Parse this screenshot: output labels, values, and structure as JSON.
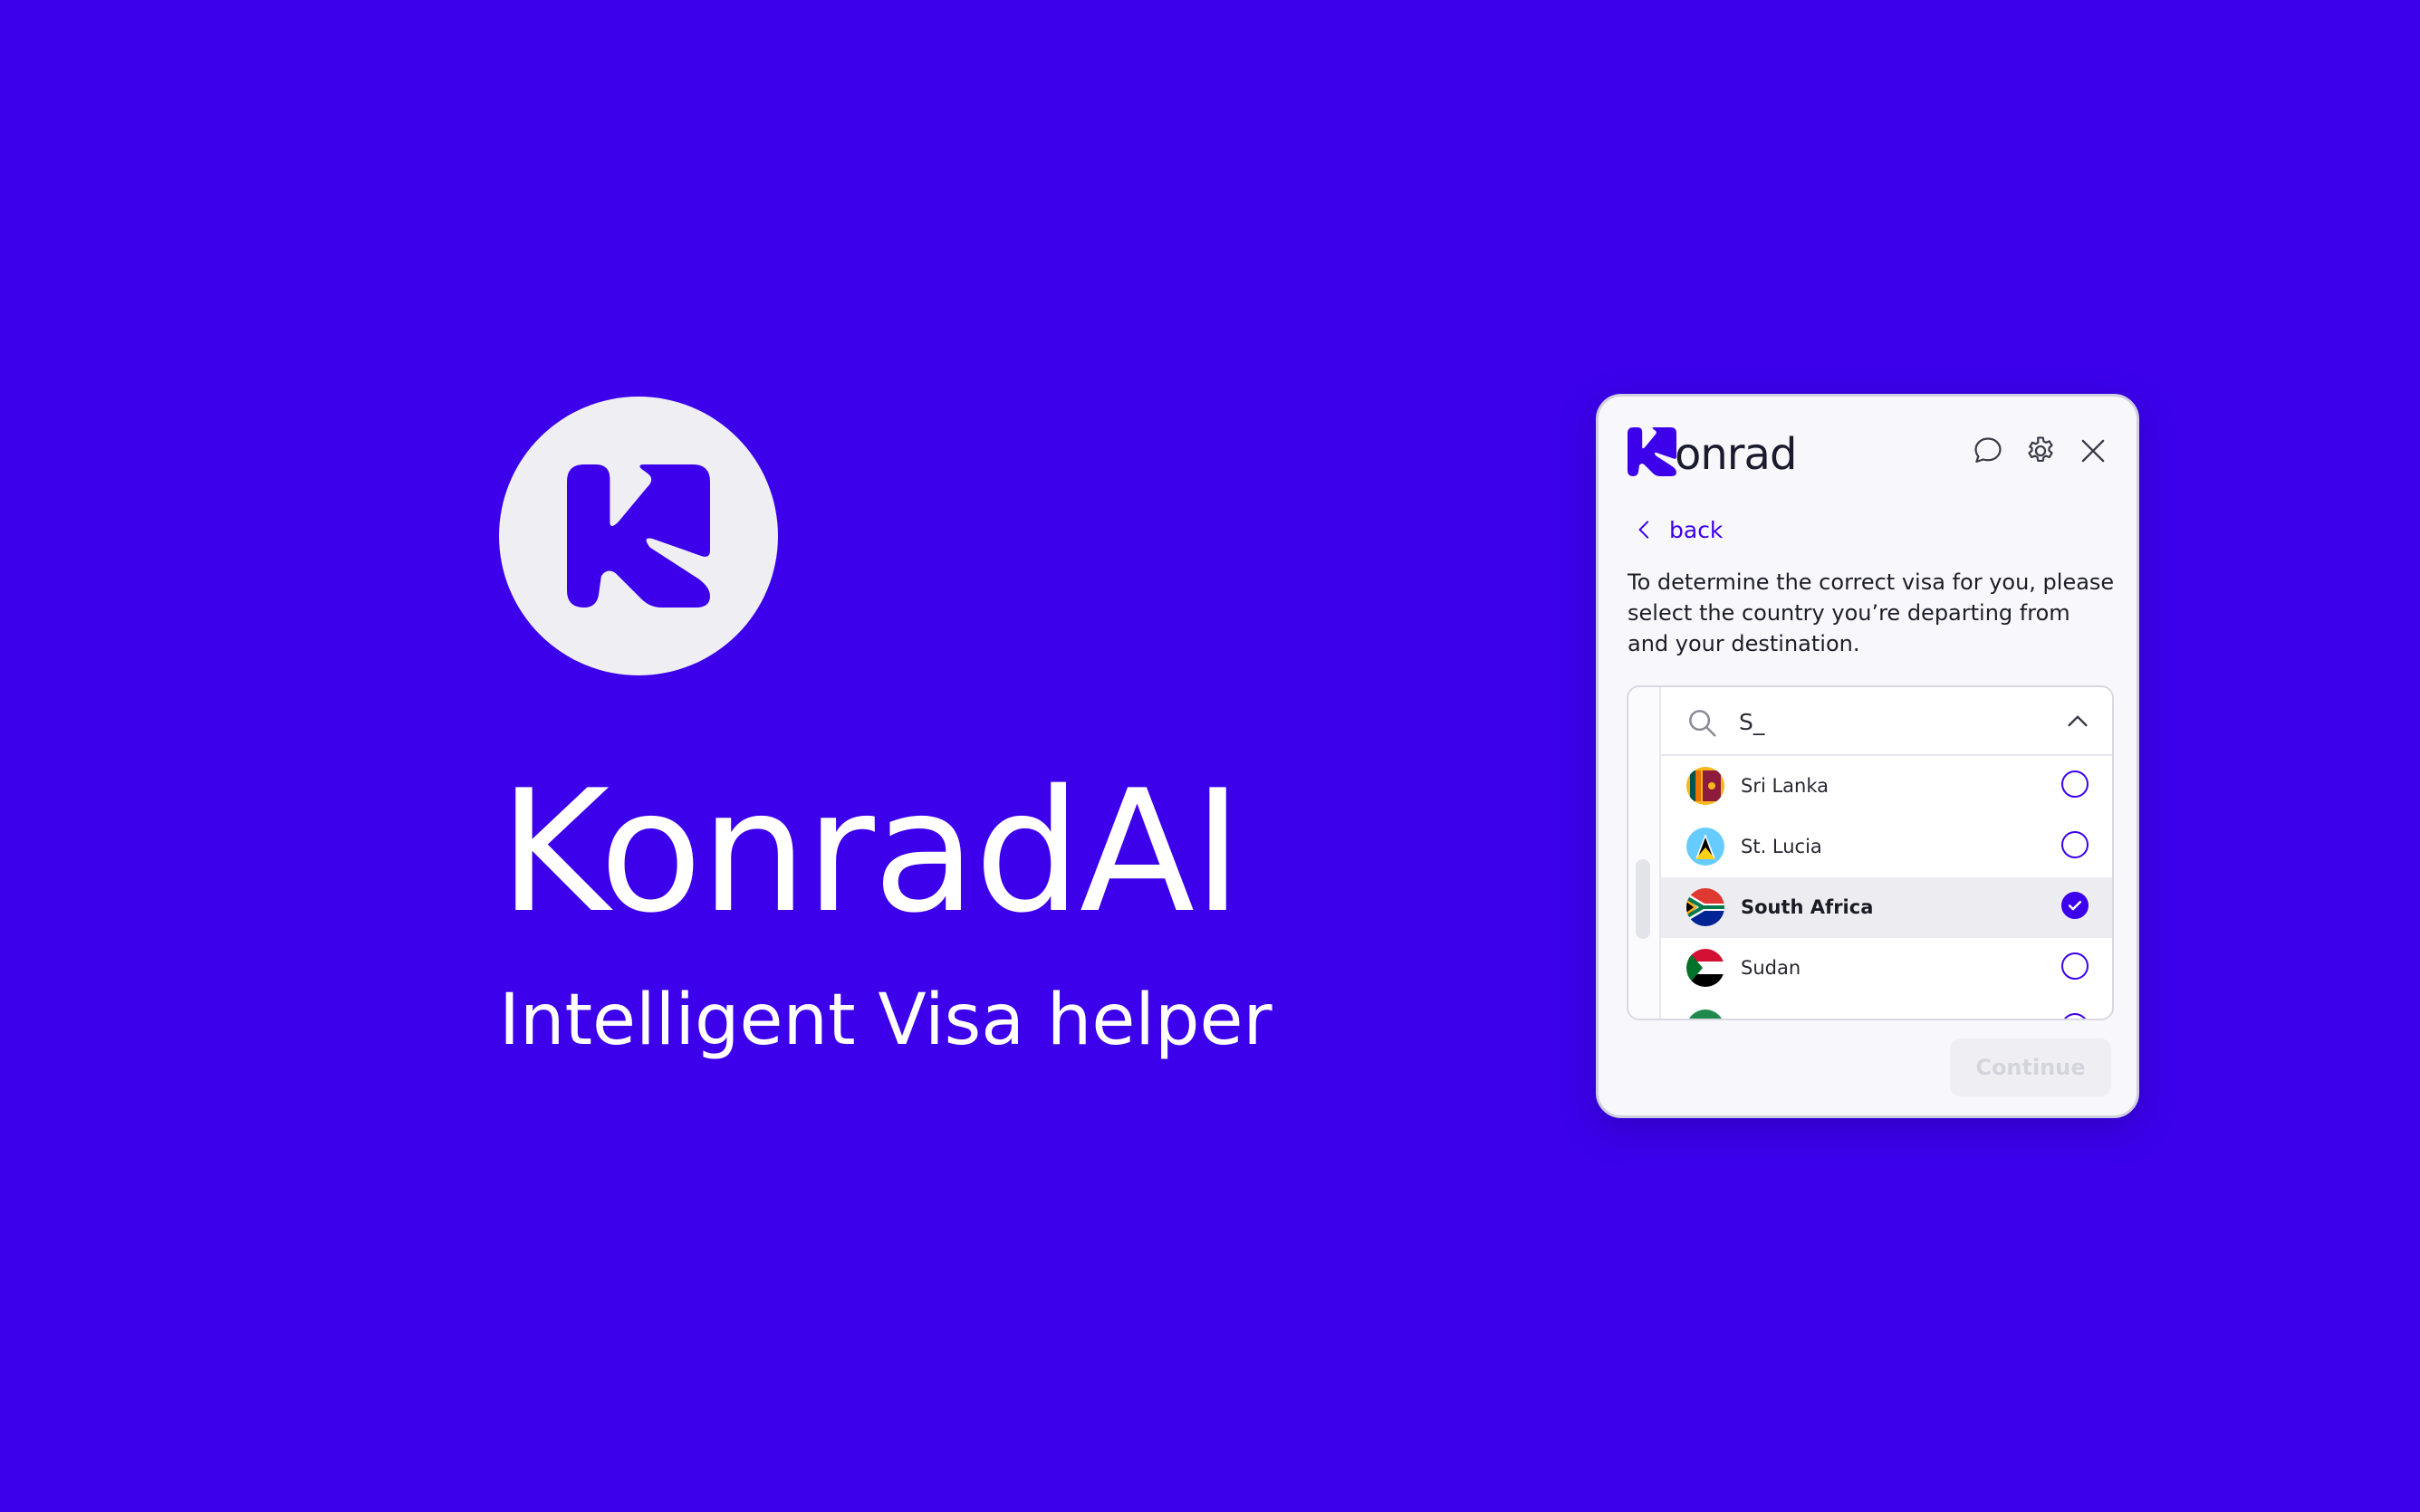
{
  "hero": {
    "title": "KonradAI",
    "subtitle": "Intelligent Visa helper",
    "logo_icon": "konrad-k-logo-icon"
  },
  "widget": {
    "brand_text": "onrad",
    "header_icons": [
      "chat-bubble-icon",
      "gear-icon",
      "close-icon"
    ],
    "back_label": "back",
    "intro": "To determine the correct visa for you, please select the country you’re departing from and your destination.",
    "search": {
      "value": "S_",
      "placeholder": ""
    },
    "options": [
      {
        "label": "Sri Lanka",
        "flag": "sri-lanka-flag-icon",
        "selected": false
      },
      {
        "label": "St. Lucia",
        "flag": "st-lucia-flag-icon",
        "selected": false
      },
      {
        "label": "South Africa",
        "flag": "south-africa-flag-icon",
        "selected": true
      },
      {
        "label": "Sudan",
        "flag": "sudan-flag-icon",
        "selected": false
      }
    ],
    "continue_label": "Continue"
  },
  "colors": {
    "background": "#3c00eb",
    "accent": "#3c00eb",
    "logo_circle": "#eeeef3",
    "widget_bg": "#f8f8fc"
  }
}
